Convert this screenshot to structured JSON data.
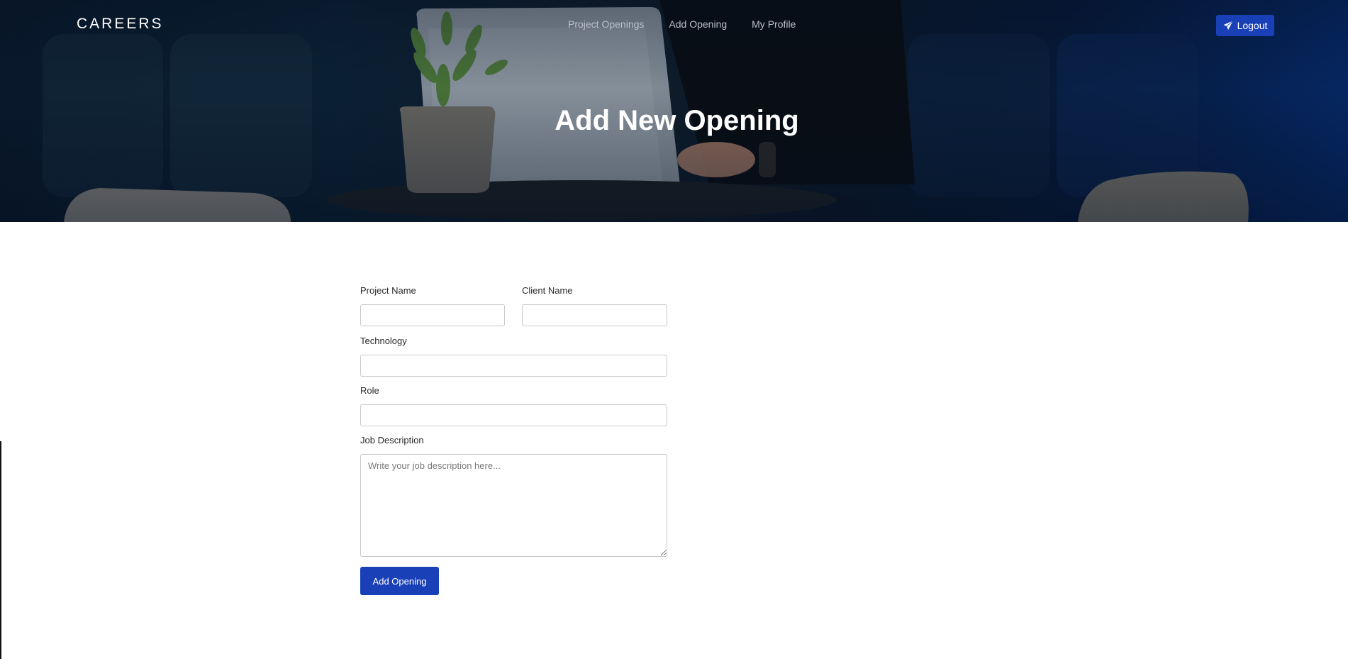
{
  "header": {
    "brand": "CAREERS",
    "nav": [
      {
        "label": "Project Openings"
      },
      {
        "label": "Add Opening"
      },
      {
        "label": "My Profile"
      }
    ],
    "logout_label": "Logout",
    "logout_icon": "paper-plane-icon"
  },
  "hero": {
    "title": "Add New Opening"
  },
  "form": {
    "project_name": {
      "label": "Project Name",
      "value": ""
    },
    "client_name": {
      "label": "Client Name",
      "value": ""
    },
    "technology": {
      "label": "Technology",
      "value": ""
    },
    "role": {
      "label": "Role",
      "value": ""
    },
    "job_description": {
      "label": "Job Description",
      "placeholder": "Write your job description here...",
      "value": ""
    },
    "submit_label": "Add Opening"
  },
  "colors": {
    "accent": "#1a40b8",
    "hero_bg": "#0b1a2a",
    "nav_text": "#b9c0cb"
  }
}
